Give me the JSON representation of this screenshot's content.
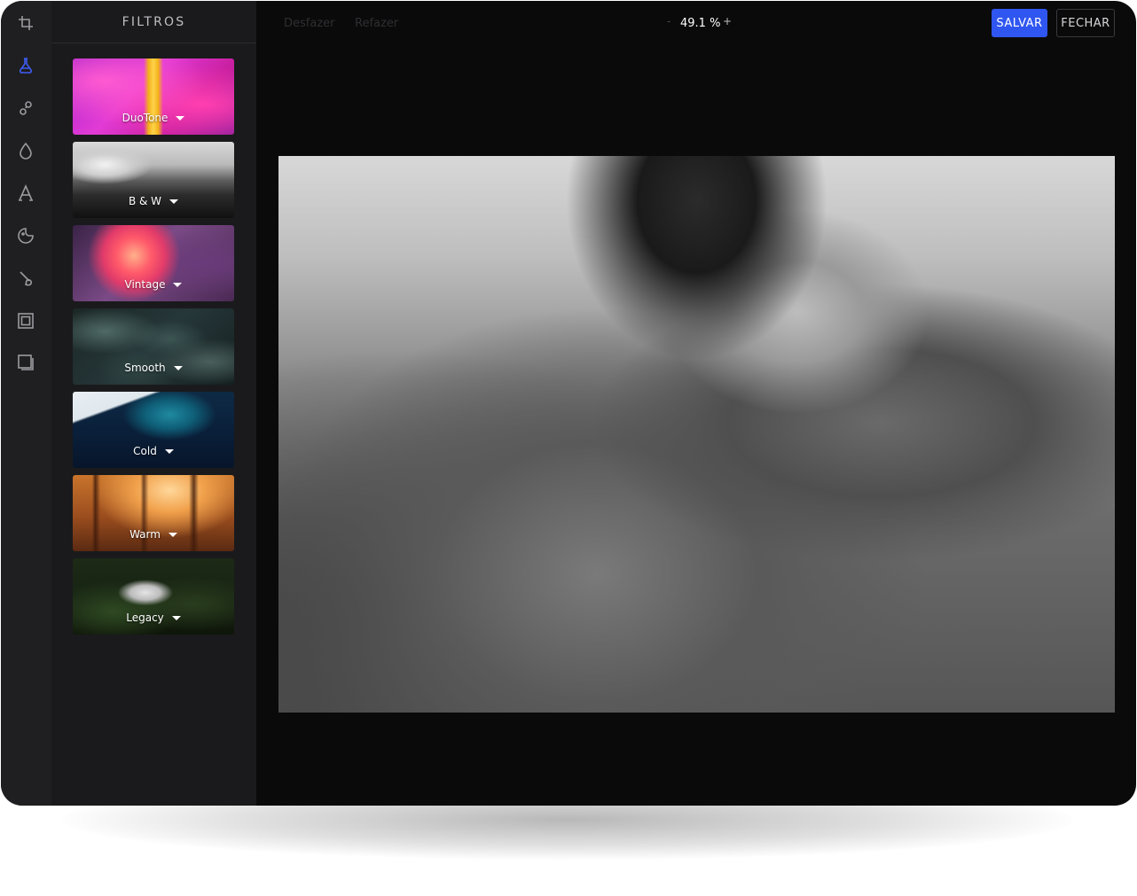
{
  "sidebar": {
    "tools": [
      {
        "icon": "crop-icon",
        "color": "#9a9aa0"
      },
      {
        "icon": "flask-icon",
        "color": "#3e5cf2"
      },
      {
        "icon": "adjust-icon",
        "color": "#9a9aa0"
      },
      {
        "icon": "drop-icon",
        "color": "#9a9aa0"
      },
      {
        "icon": "text-icon",
        "color": "#9a9aa0"
      },
      {
        "icon": "sticker-icon",
        "color": "#9a9aa0"
      },
      {
        "icon": "brush-icon",
        "color": "#9a9aa0"
      },
      {
        "icon": "frame-icon",
        "color": "#9a9aa0"
      },
      {
        "icon": "overlay-icon",
        "color": "#9a9aa0"
      }
    ]
  },
  "panel": {
    "title": "FILTROS",
    "filters": [
      {
        "label": "DuoTone"
      },
      {
        "label": "B & W"
      },
      {
        "label": "Vintage"
      },
      {
        "label": "Smooth"
      },
      {
        "label": "Cold"
      },
      {
        "label": "Warm"
      },
      {
        "label": "Legacy"
      }
    ]
  },
  "toolbar": {
    "undo_label": "Desfazer",
    "redo_label": "Refazer",
    "zoom_minus": "-",
    "zoom_value": "49.1 %",
    "zoom_plus": "+",
    "save_label": "SALVAR",
    "close_label": "FECHAR"
  },
  "colors": {
    "accent": "#2f56f0"
  }
}
